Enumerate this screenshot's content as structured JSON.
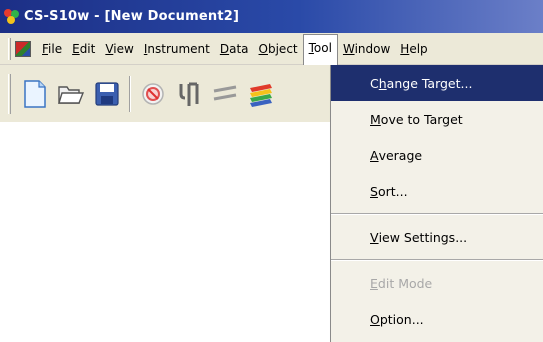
{
  "window": {
    "title": "CS-S10w - [New Document2]"
  },
  "menubar": {
    "items": [
      {
        "accel": "F",
        "rest": "ile"
      },
      {
        "accel": "E",
        "rest": "dit"
      },
      {
        "accel": "V",
        "rest": "iew"
      },
      {
        "accel": "I",
        "rest": "nstrument"
      },
      {
        "accel": "D",
        "rest": "ata"
      },
      {
        "accel": "O",
        "rest": "bject"
      },
      {
        "accel": "T",
        "rest": "ool"
      },
      {
        "accel": "W",
        "rest": "indow"
      },
      {
        "accel": "H",
        "rest": "elp"
      }
    ],
    "open_menu": "Tool"
  },
  "toolbar": {
    "buttons": [
      "new-document-icon",
      "open-folder-icon",
      "save-disk-icon",
      "target-icon",
      "tuning-fork-icon",
      "lines-icon",
      "color-layers-icon"
    ]
  },
  "tool_menu": {
    "items": [
      {
        "pre": "C",
        "accel": "h",
        "post": "ange Target...",
        "state": "highlighted"
      },
      {
        "pre": "",
        "accel": "M",
        "post": "ove to Target",
        "state": "normal"
      },
      {
        "pre": "",
        "accel": "A",
        "post": "verage",
        "state": "normal"
      },
      {
        "pre": "",
        "accel": "S",
        "post": "ort...",
        "state": "normal"
      },
      {
        "pre": "",
        "accel": "V",
        "post": "iew Settings...",
        "state": "normal"
      },
      {
        "pre": "",
        "accel": "E",
        "post": "dit Mode",
        "state": "disabled"
      },
      {
        "pre": "",
        "accel": "O",
        "post": "ption...",
        "state": "normal"
      }
    ]
  },
  "colors": {
    "titlebar": "#1c2f86",
    "highlight": "#1e2f6e",
    "menubar": "#ece9d8"
  }
}
